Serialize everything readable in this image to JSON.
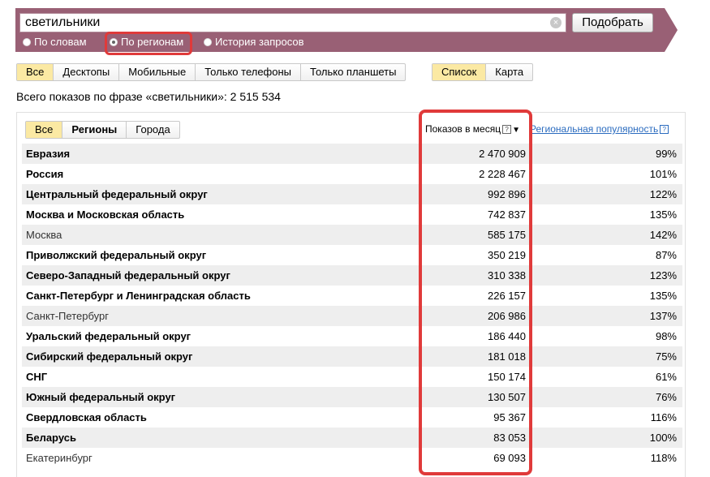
{
  "search": {
    "query": "светильники",
    "submit_label": "Подобрать",
    "clear_icon": "×"
  },
  "modes": [
    {
      "label": "По словам",
      "checked": false
    },
    {
      "label": "По регионам",
      "checked": true
    },
    {
      "label": "История запросов",
      "checked": false
    }
  ],
  "device_filter": [
    "Все",
    "Десктопы",
    "Мобильные",
    "Только телефоны",
    "Только планшеты"
  ],
  "view_filter": [
    "Список",
    "Карта"
  ],
  "total_text": "Всего показов по фразе «светильники»: 2 515 534",
  "region_filter": [
    "Все",
    "Регионы",
    "Города"
  ],
  "columns": {
    "count": "Показов в месяц",
    "popularity": "Региональная популярность",
    "help_glyph": "?",
    "sort_glyph": "▼"
  },
  "rows": [
    {
      "name": "Евразия",
      "count": "2 470 909",
      "pop": "99%",
      "bold": true
    },
    {
      "name": "Россия",
      "count": "2 228 467",
      "pop": "101%",
      "bold": true
    },
    {
      "name": "Центральный федеральный округ",
      "count": "992 896",
      "pop": "122%",
      "bold": true
    },
    {
      "name": "Москва и Московская область",
      "count": "742 837",
      "pop": "135%",
      "bold": true
    },
    {
      "name": "Москва",
      "count": "585 175",
      "pop": "142%",
      "bold": false
    },
    {
      "name": "Приволжский федеральный округ",
      "count": "350 219",
      "pop": "87%",
      "bold": true
    },
    {
      "name": "Северо-Западный федеральный округ",
      "count": "310 338",
      "pop": "123%",
      "bold": true
    },
    {
      "name": "Санкт-Петербург и Ленинградская область",
      "count": "226 157",
      "pop": "135%",
      "bold": true
    },
    {
      "name": "Санкт-Петербург",
      "count": "206 986",
      "pop": "137%",
      "bold": false
    },
    {
      "name": "Уральский федеральный округ",
      "count": "186 440",
      "pop": "98%",
      "bold": true
    },
    {
      "name": "Сибирский федеральный округ",
      "count": "181 018",
      "pop": "75%",
      "bold": true
    },
    {
      "name": "СНГ",
      "count": "150 174",
      "pop": "61%",
      "bold": true
    },
    {
      "name": "Южный федеральный округ",
      "count": "130 507",
      "pop": "76%",
      "bold": true
    },
    {
      "name": "Свердловская область",
      "count": "95 367",
      "pop": "116%",
      "bold": true
    },
    {
      "name": "Беларусь",
      "count": "83 053",
      "pop": "100%",
      "bold": true
    },
    {
      "name": "Екатеринбург",
      "count": "69 093",
      "pop": "118%",
      "bold": false
    }
  ]
}
